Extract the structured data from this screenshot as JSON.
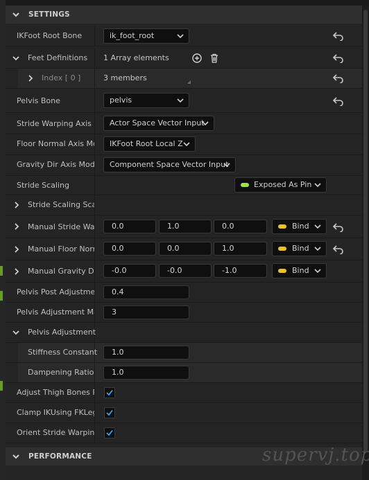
{
  "categories": {
    "settings": "SETTINGS",
    "performance": "PERFORMANCE"
  },
  "rows": {
    "ik_root_bone": {
      "label": "IKFoot Root Bone",
      "value": "ik_foot_root"
    },
    "feet_definitions": {
      "label": "Feet Definitions",
      "value": "1 Array elements"
    },
    "index0": {
      "label": "Index [ 0 ]",
      "value": "3 members"
    },
    "pelvis_bone": {
      "label": "Pelvis Bone",
      "value": "pelvis"
    },
    "stride_axis_mode": {
      "label": "Stride Warping Axis Mo",
      "value": "Actor Space Vector Input"
    },
    "floor_axis_mode": {
      "label": "Floor Normal Axis Moc",
      "value": "IKFoot Root Local Z"
    },
    "gravity_axis_mode": {
      "label": "Gravity Dir Axis Mode",
      "value": "Component Space Vector Input"
    },
    "stride_scaling": {
      "label": "Stride Scaling",
      "value": "Exposed As Pin"
    },
    "stride_scaling_scale": {
      "label": "Stride Scaling Scale"
    },
    "manual_stride": {
      "label": "Manual Stride Warp",
      "x": "0.0",
      "y": "1.0",
      "z": "0.0",
      "bind": "Bind"
    },
    "manual_floor": {
      "label": "Manual Floor Norm",
      "x": "0.0",
      "y": "0.0",
      "z": "1.0",
      "bind": "Bind"
    },
    "manual_gravity": {
      "label": "Manual Gravity Dir",
      "x": "-0.0",
      "y": "-0.0",
      "z": "-1.0",
      "bind": "Bind"
    },
    "pelvis_post_adjust": {
      "label": "Pelvis Post Adjustmer",
      "value": "0.4"
    },
    "pelvis_adjust_max": {
      "label": "Pelvis Adjustment Ma",
      "value": "3"
    },
    "pelvis_adjustment": {
      "label": "Pelvis Adjustment"
    },
    "stiffness": {
      "label": "Stiffness Constant",
      "value": "1.0"
    },
    "dampening": {
      "label": "Dampening Ratio",
      "value": "1.0"
    },
    "adjust_thigh": {
      "label": "Adjust Thigh Bones Ro",
      "checked": true
    },
    "clamp_ik": {
      "label": "Clamp IKUsing FKLeg",
      "checked": true
    },
    "orient_stride": {
      "label": "Orient Stride Warping A",
      "checked": true
    }
  },
  "colors": {
    "pin_green": "#9be34a",
    "bind_yellow": "#f0c020",
    "check_blue": "#3aa0e8"
  },
  "icons": {
    "add": "add-element-icon",
    "delete": "trash-icon",
    "reset": "reset-to-default-icon"
  },
  "watermark": "supervj.top"
}
